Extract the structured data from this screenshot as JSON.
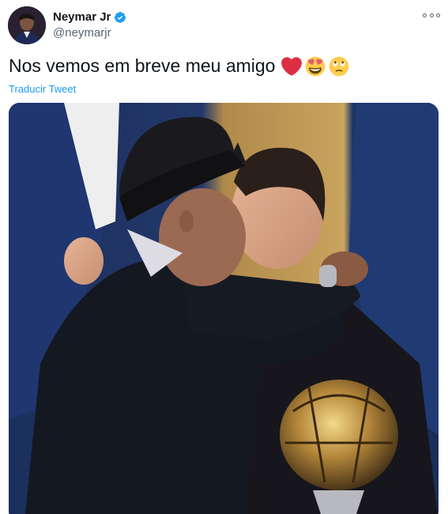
{
  "author": {
    "display_name": "Neymar Jr",
    "handle": "@neymarjr",
    "verified": true,
    "verified_color": "#1d9bf0"
  },
  "tweet": {
    "text": "Nos vemos em breve meu amigo",
    "emojis": [
      "red-heart",
      "smiling-face-with-heart-eyes",
      "face-with-rolling-eyes"
    ],
    "translate_label": "Traducir Tweet"
  },
  "icons": {
    "more": "more-options-icon",
    "verified": "verified-badge-icon"
  },
  "colors": {
    "text": "#0f1419",
    "secondary": "#536471",
    "link": "#1d9bf0"
  }
}
